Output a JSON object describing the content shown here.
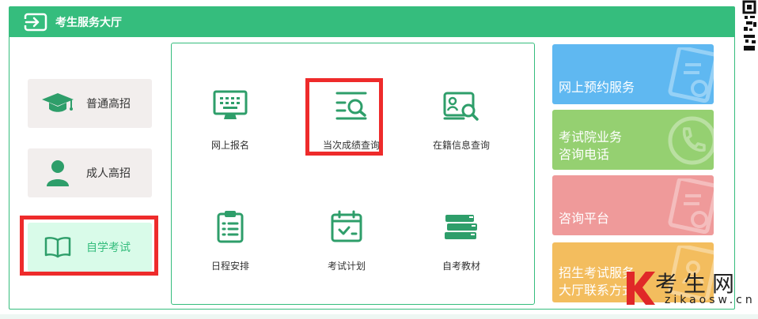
{
  "header": {
    "title": "考生服务大厅",
    "icon": "login-arrow-icon"
  },
  "categories": [
    {
      "label": "普通高招",
      "icon": "graduation-cap-icon",
      "active": false
    },
    {
      "label": "成人高招",
      "icon": "person-icon",
      "active": false
    },
    {
      "label": "自学考试",
      "icon": "open-book-icon",
      "active": true
    }
  ],
  "services": [
    {
      "label": "网上报名",
      "icon": "computer-keyboard-icon"
    },
    {
      "label": "当次成绩查询",
      "icon": "search-list-icon",
      "highlighted": true
    },
    {
      "label": "在籍信息查询",
      "icon": "id-card-search-icon"
    },
    {
      "label": "日程安排",
      "icon": "clipboard-icon"
    },
    {
      "label": "考试计划",
      "icon": "calendar-check-icon"
    },
    {
      "label": "自考教材",
      "icon": "books-icon"
    }
  ],
  "cards": [
    {
      "label": "网上预约服务",
      "color": "#5fb8f1",
      "icon": "document-icon"
    },
    {
      "label": "考试院业务\n咨询电话",
      "color": "#95d071",
      "icon": "phone-icon"
    },
    {
      "label": "咨询平台",
      "color": "#ef9a9a",
      "icon": "document-icon"
    },
    {
      "label": "招生考试服务\n大厅联系方式",
      "color": "#f3bd5e",
      "icon": "contact-card-icon"
    }
  ],
  "watermark": {
    "big": "考生网",
    "small": "zikaosw.cn",
    "logo_letter": "K"
  },
  "colors": {
    "brand": "#35bd7d",
    "highlight": "#ee2b2b",
    "active_bg": "#d9fbe9",
    "inactive_bg": "#f2eeed"
  }
}
